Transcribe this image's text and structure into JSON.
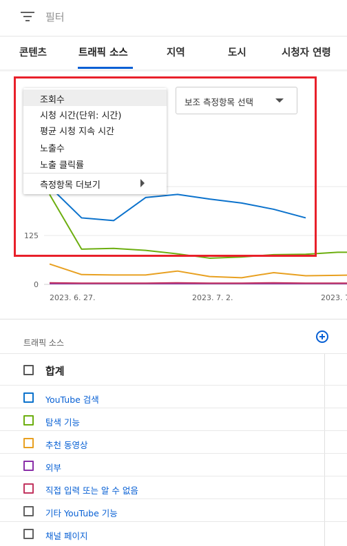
{
  "filter": {
    "label": "필터"
  },
  "tabs": [
    {
      "label": "콘텐츠"
    },
    {
      "label": "트래픽 소스"
    },
    {
      "label": "지역"
    },
    {
      "label": "도시"
    },
    {
      "label": "시청자 연령"
    }
  ],
  "metric_menu": {
    "items": [
      {
        "label": "조회수",
        "highlighted": true
      },
      {
        "label": "시청 시간(단위: 시간)"
      },
      {
        "label": "평균 시청 지속 시간"
      },
      {
        "label": "노출수"
      },
      {
        "label": "노출 클릭률"
      }
    ],
    "more_label": "측정항목 더보기"
  },
  "secondary_metric": {
    "label": "보조 측정항목 선택"
  },
  "chart_data": {
    "type": "line",
    "y_ticks": [
      "125",
      "0"
    ],
    "x_ticks": [
      "2023. 6. 27.",
      "2023. 7. 2.",
      "2023. 7"
    ],
    "series": [
      {
        "name": "YouTube 검색",
        "color": "#0b72cc",
        "values": [
          250,
          170,
          163,
          222,
          230,
          218,
          208,
          192,
          170
        ]
      },
      {
        "name": "탐색 기능",
        "color": "#6cae0f",
        "values": [
          230,
          90,
          92,
          87,
          78,
          67,
          70,
          76,
          77,
          82,
          82
        ]
      },
      {
        "name": "추천 동영상",
        "color": "#e8a020",
        "values": [
          52,
          25,
          24,
          24,
          34,
          20,
          17,
          30,
          22,
          23,
          25
        ]
      },
      {
        "name": "외부",
        "color": "#8a2ea8",
        "values": [
          2,
          2,
          2,
          2,
          2,
          2,
          2,
          2,
          2,
          2,
          2
        ]
      },
      {
        "name": "직접 입력 또는 알 수 없음",
        "color": "#c2345f",
        "values": [
          4,
          3,
          3,
          3,
          4,
          3,
          3,
          4,
          3,
          3,
          3
        ]
      }
    ]
  },
  "table": {
    "header": "트래픽 소스",
    "total_label": "합계",
    "rows": [
      {
        "label": "YouTube 검색",
        "color": "#0b72cc"
      },
      {
        "label": "탐색 기능",
        "color": "#6cae0f"
      },
      {
        "label": "추천 동영상",
        "color": "#e8a020"
      },
      {
        "label": "외부",
        "color": "#8a2ea8"
      },
      {
        "label": "직접 입력 또는 알 수 없음",
        "color": "#c2345f"
      },
      {
        "label": "기타 YouTube 기능",
        "color": "#606060"
      },
      {
        "label": "채널 페이지",
        "color": "#606060"
      }
    ]
  },
  "colors": {
    "accent": "#065fd4",
    "highlight_box": "#e8202a"
  }
}
